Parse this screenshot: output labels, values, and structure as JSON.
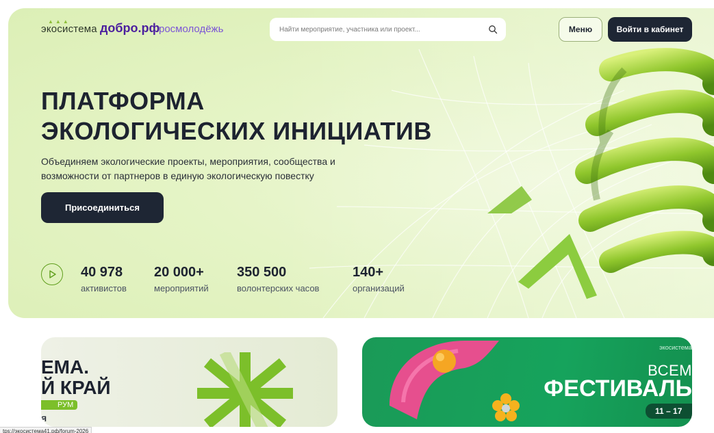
{
  "header": {
    "logo_ecosystem": "экосистема",
    "logo_dobro": "добро.рф",
    "logo_rosmolodezh": "росмолодёжь",
    "search_placeholder": "Найти мероприятие, участника или проект...",
    "menu_label": "Меню",
    "login_label": "Войти в кабинет"
  },
  "hero": {
    "title_line1": "ПЛАТФОРМА",
    "title_line2": "ЭКОЛОГИЧЕСКИХ ИНИЦИАТИВ",
    "subtitle_line1": "Объединяем экологические проекты, мероприятия, сообщества и",
    "subtitle_line2": "возможности от партнеров в единую экологическую повестку",
    "join_label": "Присоединиться"
  },
  "stats": [
    {
      "value": "40 978",
      "label": "активистов"
    },
    {
      "value": "20 000+",
      "label": "мероприятий"
    },
    {
      "value": "350 500",
      "label": "волонтерских часов"
    },
    {
      "value": "140+",
      "label": "организаций"
    }
  ],
  "cards": {
    "left": {
      "line1": "ЕМА.",
      "line2": "Й КРАЙ",
      "badge": "РУМ",
      "small": "Я"
    },
    "right": {
      "logo": "экосистема",
      "line1": "ВСЕМ",
      "line2": "ФЕСТИВАЛЬ",
      "date": "11 – 17"
    }
  },
  "status_bar": {
    "url": "tps://экосистема41.рф/forum-2026"
  },
  "colors": {
    "accent_dark": "#1e2634",
    "accent_green": "#7cbf2a",
    "festival_green": "#16a35c",
    "brand_purple": "#4b1f9e"
  }
}
